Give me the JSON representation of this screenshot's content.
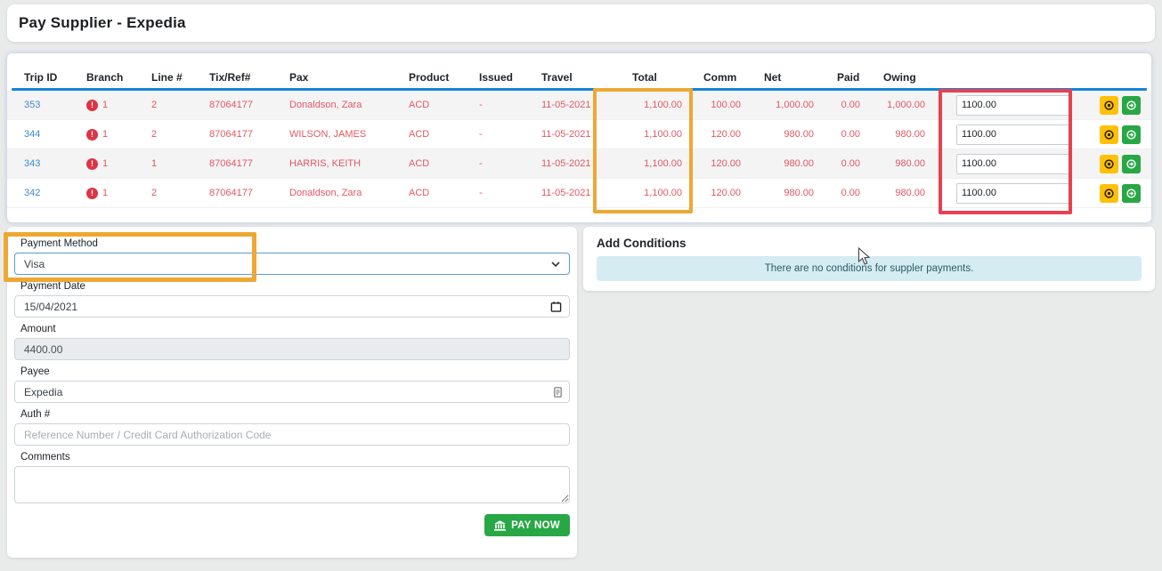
{
  "page": {
    "title": "Pay Supplier - Expedia"
  },
  "table": {
    "columns": [
      "Trip ID",
      "Branch",
      "Line #",
      "Tix/Ref#",
      "Pax",
      "Product",
      "Issued",
      "Travel",
      "Total",
      "Comm",
      "Net",
      "Paid",
      "Owing"
    ],
    "rows": [
      {
        "trip_id": "353",
        "branch_alert": "!",
        "branch": "1",
        "line": "2",
        "tix": "87064177",
        "pax": "Donaldson, Zara",
        "product": "ACD",
        "issued": "-",
        "travel": "11-05-2021",
        "total": "1,100.00",
        "comm": "100.00",
        "net": "1,000.00",
        "paid": "0.00",
        "owing": "1,000.00",
        "amount_input": "1100.00"
      },
      {
        "trip_id": "344",
        "branch_alert": "!",
        "branch": "1",
        "line": "2",
        "tix": "87064177",
        "pax": "WILSON, JAMES",
        "product": "ACD",
        "issued": "-",
        "travel": "11-05-2021",
        "total": "1,100.00",
        "comm": "120.00",
        "net": "980.00",
        "paid": "0.00",
        "owing": "980.00",
        "amount_input": "1100.00"
      },
      {
        "trip_id": "343",
        "branch_alert": "!",
        "branch": "1",
        "line": "1",
        "tix": "87064177",
        "pax": "HARRIS, KEITH",
        "product": "ACD",
        "issued": "-",
        "travel": "11-05-2021",
        "total": "1,100.00",
        "comm": "120.00",
        "net": "980.00",
        "paid": "0.00",
        "owing": "980.00",
        "amount_input": "1100.00"
      },
      {
        "trip_id": "342",
        "branch_alert": "!",
        "branch": "1",
        "line": "2",
        "tix": "87064177",
        "pax": "Donaldson, Zara",
        "product": "ACD",
        "issued": "-",
        "travel": "11-05-2021",
        "total": "1,100.00",
        "comm": "120.00",
        "net": "980.00",
        "paid": "0.00",
        "owing": "980.00",
        "amount_input": "1100.00"
      }
    ]
  },
  "form": {
    "payment_method": {
      "label": "Payment Method",
      "value": "Visa"
    },
    "payment_date": {
      "label": "Payment Date",
      "value": "15/04/2021"
    },
    "amount": {
      "label": "Amount",
      "value": "4400.00"
    },
    "payee": {
      "label": "Payee",
      "value": "Expedia"
    },
    "auth": {
      "label": "Auth #",
      "placeholder": "Reference Number / Credit Card Authorization Code"
    },
    "comments": {
      "label": "Comments",
      "value": ""
    },
    "pay_now_label": "PAY NOW"
  },
  "conditions": {
    "title": "Add Conditions",
    "empty_message": "There are no conditions for suppler payments."
  },
  "icons": {
    "branch_alert": "exclamation-circle-icon",
    "row_action_yellow": "circle-dot-icon",
    "row_action_green": "circle-arrow-icon",
    "select_chevron": "chevron-down-icon",
    "date_field": "calendar-icon",
    "payee_field": "contact-card-icon",
    "pay_now": "bank-icon"
  },
  "colors": {
    "accent_blue": "#1285d8",
    "link_blue": "#3d8bd4",
    "danger_text": "#e25864",
    "warning_yellow": "#ffc107",
    "success_green": "#28a745",
    "info_banner_bg": "#d4ecf2",
    "annotation_orange": "#efa733",
    "annotation_red": "#e94050"
  }
}
